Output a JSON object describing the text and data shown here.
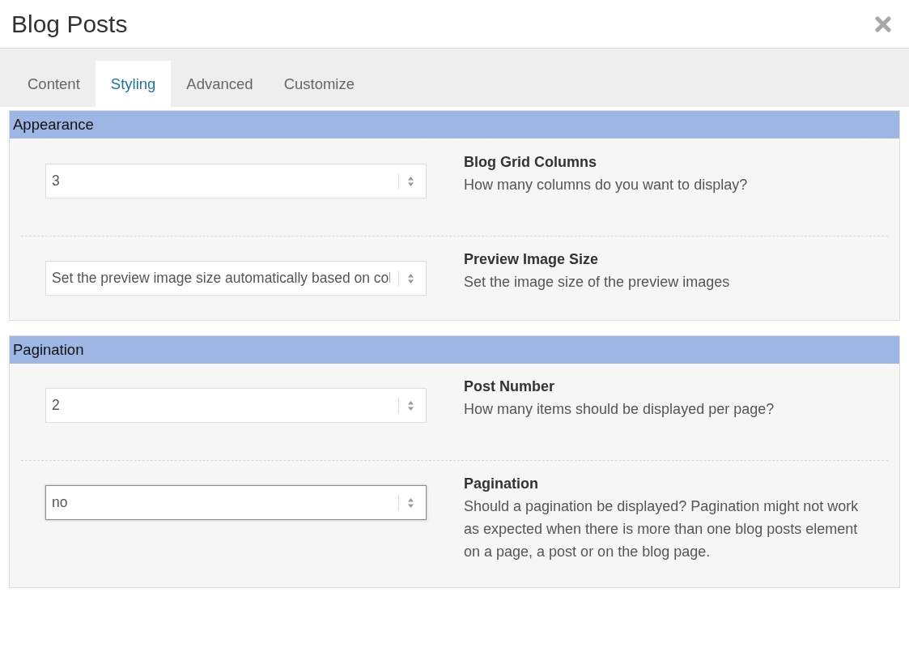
{
  "window": {
    "title": "Blog Posts"
  },
  "tabs": [
    {
      "label": "Content",
      "selected": false
    },
    {
      "label": "Styling",
      "selected": true
    },
    {
      "label": "Advanced",
      "selected": false
    },
    {
      "label": "Customize",
      "selected": false
    }
  ],
  "sections": [
    {
      "title": "Appearance",
      "options": [
        {
          "value": "3",
          "focused": false,
          "label": "Blog Grid Columns",
          "description": "How many columns do you want to display?"
        },
        {
          "value": "Set the preview image size automatically based on col",
          "focused": false,
          "label": "Preview Image Size",
          "description": "Set the image size of the preview images"
        }
      ]
    },
    {
      "title": "Pagination",
      "options": [
        {
          "value": "2",
          "focused": false,
          "label": "Post Number",
          "description": "How many items should be displayed per page?"
        },
        {
          "value": "no",
          "focused": true,
          "label": "Pagination",
          "description": "Should a pagination be displayed? Pagination might not work as expected when there is more than one blog posts element on a page, a post or on the blog page."
        }
      ]
    }
  ]
}
